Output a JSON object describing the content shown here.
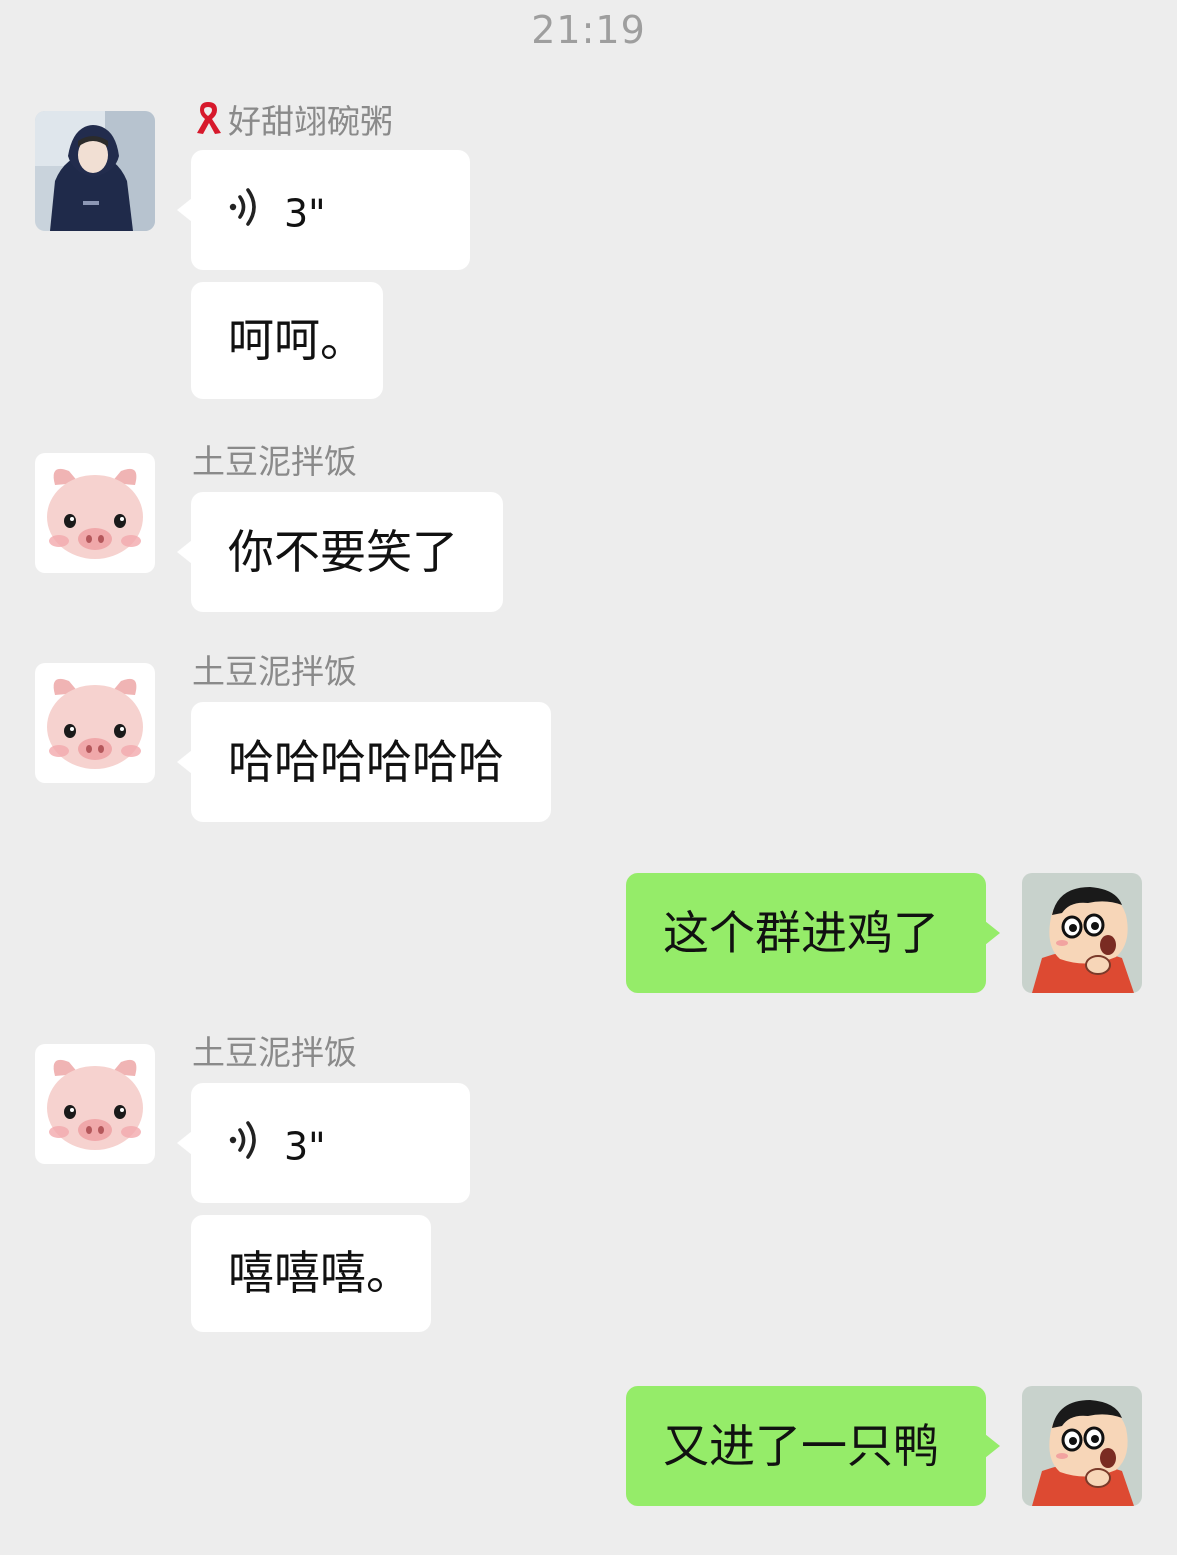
{
  "timestamp": "21:19",
  "messages": [
    {
      "sender": "好甜翊碗粥",
      "badge_icon": "red-ribbon-icon",
      "kind": "voice",
      "duration": "3\"",
      "avatar": "photo-avatar"
    },
    {
      "sender": "好甜翊碗粥",
      "kind": "text",
      "text": "呵呵。"
    },
    {
      "sender": "土豆泥拌饭",
      "kind": "text",
      "text": "你不要笑了",
      "avatar": "pig-avatar"
    },
    {
      "sender": "土豆泥拌饭",
      "kind": "text",
      "text": "哈哈哈哈哈哈",
      "avatar": "pig-avatar"
    },
    {
      "sender": "me",
      "kind": "text",
      "text": "这个群进鸡了",
      "avatar": "cartoon-boy-avatar"
    },
    {
      "sender": "土豆泥拌饭",
      "kind": "voice",
      "duration": "3\"",
      "avatar": "pig-avatar"
    },
    {
      "sender": "土豆泥拌饭",
      "kind": "text",
      "text": "嘻嘻嘻。"
    },
    {
      "sender": "me",
      "kind": "text",
      "text": "又进了一只鸭",
      "avatar": "cartoon-boy-avatar"
    }
  ],
  "colors": {
    "background": "#ededed",
    "incoming_bubble": "#ffffff",
    "outgoing_bubble": "#95ec69",
    "sender_name": "#8a8a8a",
    "timestamp": "#9e9e9e"
  }
}
